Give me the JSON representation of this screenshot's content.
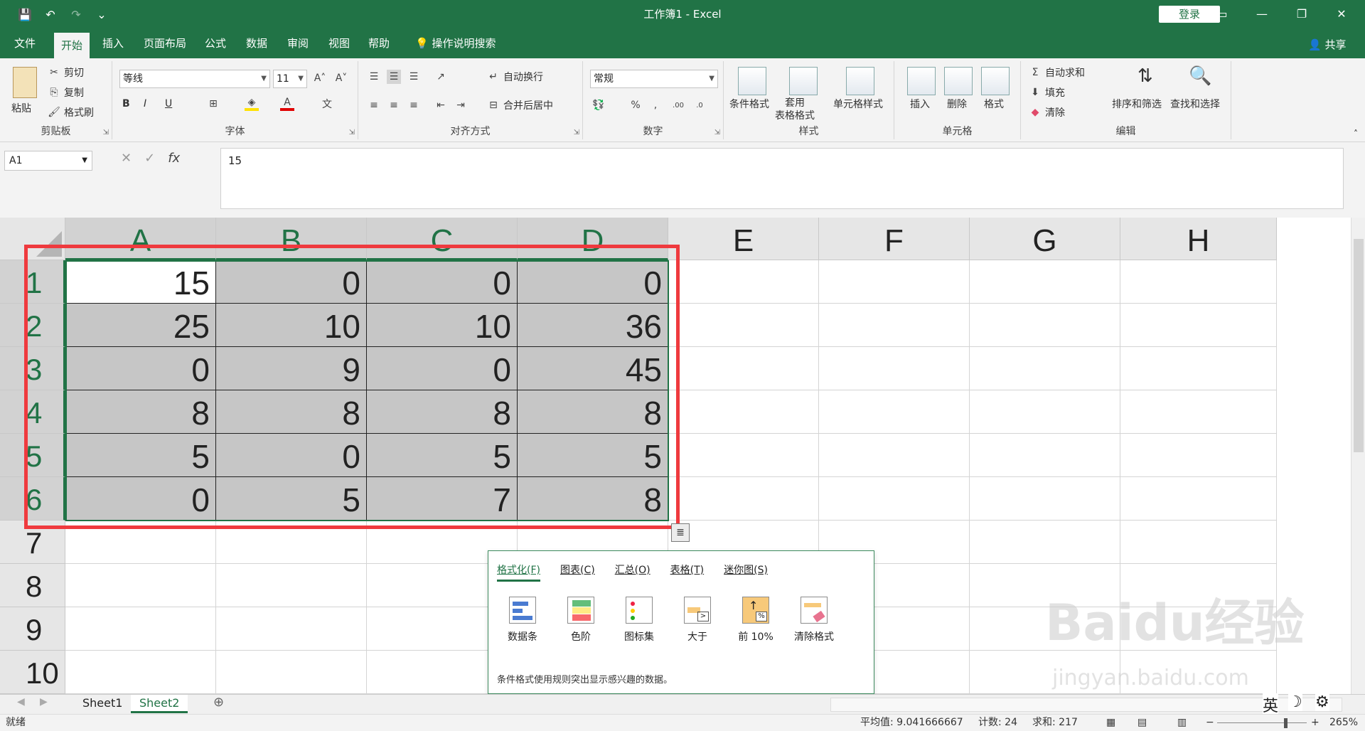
{
  "window": {
    "title": "工作簿1  -  Excel",
    "login": "登录"
  },
  "qat": {
    "save": "💾",
    "undo": "↶",
    "redo": "↷",
    "more": "⌄"
  },
  "menu": {
    "tabs": [
      "文件",
      "开始",
      "插入",
      "页面布局",
      "公式",
      "数据",
      "审阅",
      "视图",
      "帮助"
    ],
    "search": "操作说明搜索",
    "share": "共享"
  },
  "ribbon": {
    "clipboard": {
      "label": "剪贴板",
      "paste": "粘贴",
      "cut": "剪切",
      "copy": "复制",
      "painter": "格式刷"
    },
    "font": {
      "label": "字体",
      "name": "等线",
      "size": "11",
      "bold": "B",
      "italic": "I",
      "underline": "U"
    },
    "alignment": {
      "label": "对齐方式",
      "wrap": "自动换行",
      "merge": "合并后居中"
    },
    "number": {
      "label": "数字",
      "format": "常规"
    },
    "styles": {
      "label": "样式",
      "conditional": "条件格式",
      "table": "套用\n表格格式",
      "cell": "单元格样式"
    },
    "cells": {
      "label": "单元格",
      "insert": "插入",
      "delete": "删除",
      "format": "格式"
    },
    "editing": {
      "label": "编辑",
      "autosum": "自动求和",
      "fill": "填充",
      "clear": "清除",
      "sort": "排序和筛选",
      "find": "查找和选择"
    }
  },
  "formula_bar": {
    "namebox": "A1",
    "value": "15"
  },
  "grid": {
    "columns": [
      "A",
      "B",
      "C",
      "D",
      "E",
      "F",
      "G",
      "H"
    ],
    "rows": [
      "1",
      "2",
      "3",
      "4",
      "5",
      "6",
      "7",
      "8",
      "9",
      "10"
    ],
    "values": [
      [
        "15",
        "0",
        "0",
        "0"
      ],
      [
        "25",
        "10",
        "10",
        "36"
      ],
      [
        "0",
        "9",
        "0",
        "45"
      ],
      [
        "8",
        "8",
        "8",
        "8"
      ],
      [
        "5",
        "0",
        "5",
        "5"
      ],
      [
        "0",
        "5",
        "7",
        "8"
      ]
    ]
  },
  "quick_analysis": {
    "tabs": [
      "格式化(F)",
      "图表(C)",
      "汇总(O)",
      "表格(T)",
      "迷你图(S)"
    ],
    "options": [
      "数据条",
      "色阶",
      "图标集",
      "大于",
      "前 10%",
      "清除格式"
    ],
    "description": "条件格式使用规则突出显示感兴趣的数据。"
  },
  "sheets": [
    "Sheet1",
    "Sheet2"
  ],
  "status": {
    "ready": "就绪",
    "average": "平均值: 9.041666667",
    "count": "计数: 24",
    "sum": "求和: 217",
    "zoom": "265%"
  },
  "ime": {
    "lang": "英",
    "moon": "☽",
    "gear": "⚙"
  },
  "watermark": {
    "line1": "Baidu经验",
    "line2": "jingyan.baidu.com"
  },
  "colors": {
    "accent": "#217346",
    "highlight": "#ef3a3e"
  }
}
